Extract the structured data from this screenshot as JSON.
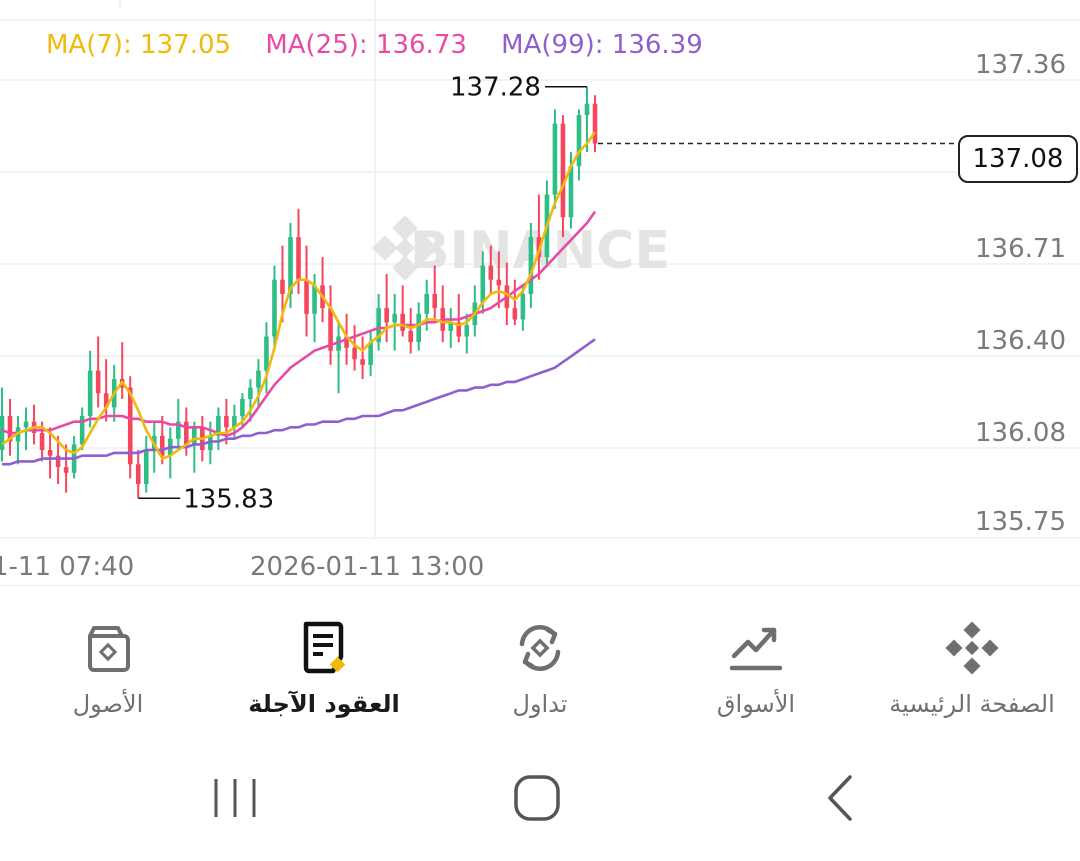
{
  "ma_legend": {
    "ma7": "MA(7): 137.05",
    "ma25": "MA(25): 136.73",
    "ma99": "MA(99): 136.39",
    "colors": {
      "ma7": "#f0b90b",
      "ma25": "#e84aa6",
      "ma99": "#8e5fcf"
    }
  },
  "watermark": "BINANCE",
  "current_price": "137.08",
  "chart_data": {
    "type": "candlestick",
    "y_axis_ticks": [
      "137.36",
      "137.08",
      "136.71",
      "136.40",
      "136.08",
      "135.75"
    ],
    "x_axis_labels": [
      "1-11 07:40",
      "2026-01-11 13:00"
    ],
    "annotations": {
      "high": "137.28",
      "low": "135.83"
    },
    "colors": {
      "up": "#2ebd85",
      "down": "#f6465d"
    },
    "candles": [
      [
        136.0,
        136.22,
        135.96,
        136.12
      ],
      [
        136.12,
        136.18,
        135.98,
        136.03
      ],
      [
        136.03,
        136.12,
        135.95,
        136.08
      ],
      [
        136.08,
        136.15,
        136.0,
        136.1
      ],
      [
        136.1,
        136.16,
        136.02,
        136.06
      ],
      [
        136.06,
        136.1,
        135.96,
        136.0
      ],
      [
        136.0,
        136.08,
        135.9,
        135.98
      ],
      [
        135.98,
        136.05,
        135.88,
        135.94
      ],
      [
        135.94,
        136.02,
        135.85,
        135.92
      ],
      [
        135.92,
        136.05,
        135.9,
        136.02
      ],
      [
        136.02,
        136.15,
        136.0,
        136.12
      ],
      [
        136.12,
        136.35,
        136.08,
        136.28
      ],
      [
        136.28,
        136.4,
        136.15,
        136.2
      ],
      [
        136.2,
        136.32,
        136.1,
        136.15
      ],
      [
        136.15,
        136.3,
        136.1,
        136.25
      ],
      [
        136.25,
        136.38,
        136.18,
        136.22
      ],
      [
        136.22,
        136.26,
        135.9,
        135.95
      ],
      [
        135.95,
        136.0,
        135.83,
        135.88
      ],
      [
        135.88,
        136.05,
        135.85,
        136.0
      ],
      [
        136.0,
        136.1,
        135.92,
        136.05
      ],
      [
        136.05,
        136.12,
        135.95,
        135.98
      ],
      [
        135.98,
        136.08,
        135.9,
        136.04
      ],
      [
        136.04,
        136.18,
        136.0,
        136.1
      ],
      [
        136.1,
        136.15,
        135.98,
        136.02
      ],
      [
        136.02,
        136.1,
        135.92,
        136.08
      ],
      [
        136.08,
        136.12,
        135.96,
        136.0
      ],
      [
        136.0,
        136.1,
        135.95,
        136.05
      ],
      [
        136.05,
        136.15,
        136.0,
        136.12
      ],
      [
        136.12,
        136.18,
        136.02,
        136.08
      ],
      [
        136.08,
        136.16,
        136.04,
        136.12
      ],
      [
        136.12,
        136.2,
        136.08,
        136.18
      ],
      [
        136.18,
        136.25,
        136.1,
        136.22
      ],
      [
        136.22,
        136.32,
        136.15,
        136.28
      ],
      [
        136.28,
        136.45,
        136.2,
        136.4
      ],
      [
        136.4,
        136.65,
        136.35,
        136.6
      ],
      [
        136.6,
        136.72,
        136.45,
        136.55
      ],
      [
        136.55,
        136.8,
        136.5,
        136.75
      ],
      [
        136.75,
        136.85,
        136.55,
        136.6
      ],
      [
        136.6,
        136.72,
        136.4,
        136.48
      ],
      [
        136.48,
        136.62,
        136.38,
        136.58
      ],
      [
        136.58,
        136.68,
        136.45,
        136.5
      ],
      [
        136.5,
        136.58,
        136.3,
        136.35
      ],
      [
        136.35,
        136.45,
        136.2,
        136.4
      ],
      [
        136.4,
        136.48,
        136.3,
        136.36
      ],
      [
        136.36,
        136.44,
        136.28,
        136.32
      ],
      [
        136.32,
        136.4,
        136.25,
        136.3
      ],
      [
        136.3,
        136.42,
        136.26,
        136.38
      ],
      [
        136.38,
        136.55,
        136.35,
        136.5
      ],
      [
        136.5,
        136.62,
        136.38,
        136.45
      ],
      [
        136.45,
        136.55,
        136.35,
        136.48
      ],
      [
        136.48,
        136.58,
        136.4,
        136.42
      ],
      [
        136.42,
        136.5,
        136.34,
        136.38
      ],
      [
        136.38,
        136.52,
        136.35,
        136.48
      ],
      [
        136.48,
        136.6,
        136.42,
        136.55
      ],
      [
        136.55,
        136.65,
        136.45,
        136.5
      ],
      [
        136.5,
        136.58,
        136.38,
        136.42
      ],
      [
        136.42,
        136.5,
        136.36,
        136.45
      ],
      [
        136.45,
        136.55,
        136.38,
        136.4
      ],
      [
        136.4,
        136.48,
        136.34,
        136.44
      ],
      [
        136.44,
        136.58,
        136.4,
        136.52
      ],
      [
        136.52,
        136.7,
        136.48,
        136.65
      ],
      [
        136.65,
        136.72,
        136.55,
        136.6
      ],
      [
        136.6,
        136.7,
        136.5,
        136.58
      ],
      [
        136.58,
        136.66,
        136.44,
        136.5
      ],
      [
        136.5,
        136.6,
        136.44,
        136.46
      ],
      [
        136.46,
        136.58,
        136.42,
        136.55
      ],
      [
        136.55,
        136.8,
        136.5,
        136.75
      ],
      [
        136.75,
        136.9,
        136.6,
        136.68
      ],
      [
        136.68,
        136.95,
        136.65,
        136.9
      ],
      [
        136.9,
        137.2,
        136.85,
        137.15
      ],
      [
        137.15,
        137.18,
        136.75,
        136.82
      ],
      [
        136.82,
        137.05,
        136.78,
        137.0
      ],
      [
        137.0,
        137.2,
        136.95,
        137.18
      ],
      [
        137.18,
        137.28,
        137.05,
        137.22
      ],
      [
        137.22,
        137.25,
        137.05,
        137.08
      ]
    ],
    "ma7": [
      136.02,
      136.04,
      136.06,
      136.07,
      136.08,
      136.08,
      136.06,
      136.03,
      136.0,
      135.99,
      136.01,
      136.06,
      136.11,
      136.15,
      136.2,
      136.24,
      136.2,
      136.14,
      136.07,
      136.02,
      135.97,
      135.98,
      136.0,
      136.02,
      136.04,
      136.04,
      136.05,
      136.06,
      136.06,
      136.08,
      136.1,
      136.14,
      136.19,
      136.26,
      136.36,
      136.48,
      136.57,
      136.6,
      136.6,
      136.58,
      136.54,
      136.5,
      136.45,
      136.4,
      136.37,
      136.35,
      136.38,
      136.4,
      136.43,
      136.44,
      136.44,
      136.43,
      136.44,
      136.46,
      136.46,
      136.45,
      136.45,
      136.44,
      136.45,
      136.48,
      136.52,
      136.55,
      136.56,
      136.55,
      136.53,
      136.56,
      136.62,
      136.7,
      136.79,
      136.87,
      136.93,
      137.0,
      137.05,
      137.08,
      137.12
    ],
    "ma25": [
      136.07,
      136.06,
      136.06,
      136.07,
      136.07,
      136.07,
      136.07,
      136.08,
      136.09,
      136.1,
      136.1,
      136.11,
      136.11,
      136.12,
      136.12,
      136.12,
      136.11,
      136.11,
      136.1,
      136.1,
      136.1,
      136.09,
      136.09,
      136.08,
      136.08,
      136.08,
      136.07,
      136.06,
      136.05,
      136.06,
      136.08,
      136.11,
      136.15,
      136.19,
      136.23,
      136.26,
      136.29,
      136.31,
      136.33,
      136.35,
      136.36,
      136.37,
      136.38,
      136.39,
      136.4,
      136.41,
      136.42,
      136.43,
      136.43,
      136.44,
      136.44,
      136.44,
      136.44,
      136.45,
      136.45,
      136.46,
      136.46,
      136.46,
      136.47,
      136.48,
      136.49,
      136.5,
      136.52,
      136.54,
      136.56,
      136.58,
      136.6,
      136.62,
      136.65,
      136.68,
      136.71,
      136.74,
      136.77,
      136.8,
      136.84
    ],
    "ma99": [
      135.95,
      135.95,
      135.96,
      135.96,
      135.96,
      135.97,
      135.97,
      135.97,
      135.97,
      135.97,
      135.98,
      135.98,
      135.98,
      135.98,
      135.99,
      135.99,
      135.99,
      135.99,
      136.0,
      136.0,
      136.0,
      136.01,
      136.01,
      136.01,
      136.02,
      136.02,
      136.03,
      136.03,
      136.04,
      136.04,
      136.05,
      136.05,
      136.06,
      136.06,
      136.07,
      136.07,
      136.08,
      136.08,
      136.09,
      136.09,
      136.1,
      136.1,
      136.1,
      136.11,
      136.11,
      136.12,
      136.12,
      136.12,
      136.13,
      136.14,
      136.14,
      136.15,
      136.16,
      136.17,
      136.18,
      136.19,
      136.2,
      136.21,
      136.21,
      136.22,
      136.22,
      136.23,
      136.23,
      136.24,
      136.24,
      136.25,
      136.26,
      136.27,
      136.28,
      136.29,
      136.31,
      136.33,
      136.35,
      136.37,
      136.39
    ]
  },
  "nav": {
    "items": [
      {
        "label": "الأصول",
        "icon": "wallet-icon"
      },
      {
        "label": "العقود الآجلة",
        "icon": "futures-icon",
        "active": true
      },
      {
        "label": "تداول",
        "icon": "trade-icon"
      },
      {
        "label": "الأسواق",
        "icon": "markets-icon"
      },
      {
        "label": "الصفحة الرئيسية",
        "icon": "binance-home-icon"
      }
    ]
  },
  "system_nav": {
    "buttons": [
      "recents-icon",
      "home-icon",
      "back-icon"
    ]
  }
}
